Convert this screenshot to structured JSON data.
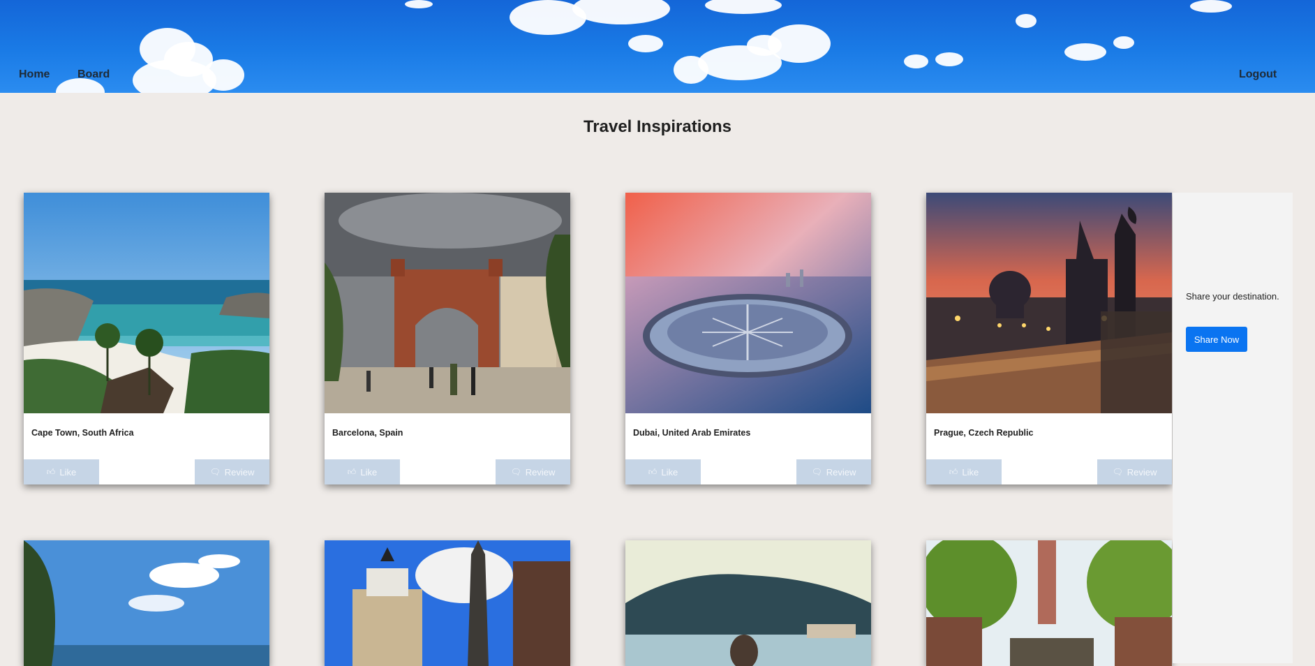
{
  "nav": {
    "home_label": "Home",
    "board_label": "Board",
    "logout_label": "Logout"
  },
  "page": {
    "title": "Travel Inspirations"
  },
  "cards": [
    {
      "caption": "Cape Town, South Africa",
      "like_label": "Like",
      "review_label": "Review"
    },
    {
      "caption": "Barcelona, Spain",
      "like_label": "Like",
      "review_label": "Review"
    },
    {
      "caption": "Dubai, United Arab Emirates",
      "like_label": "Like",
      "review_label": "Review"
    },
    {
      "caption": "Prague, Czech Republic",
      "like_label": "Like",
      "review_label": "Review"
    }
  ],
  "side": {
    "prompt": "Share your destination.",
    "share_label": "Share Now"
  },
  "icons": {
    "like": "thumbs-up-icon",
    "review": "comment-icon"
  },
  "colors": {
    "accent": "#0a74f1",
    "card_button": "#c6d5e6",
    "background": "#efebe8",
    "header_sky": "#1a7be6"
  }
}
